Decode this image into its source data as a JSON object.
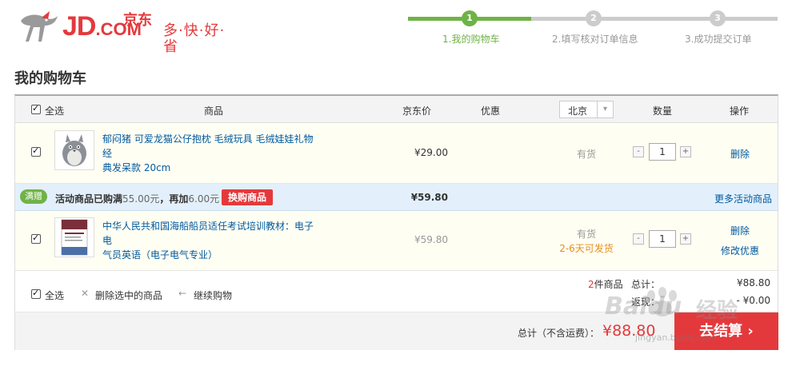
{
  "header": {
    "logo_text": "JD",
    "logo_com": ".COM",
    "logo_cn": "京东",
    "slogan": "多·快·好·省",
    "steps": [
      {
        "num": "1",
        "label": "1.我的购物车"
      },
      {
        "num": "2",
        "label": "2.填写核对订单信息"
      },
      {
        "num": "3",
        "label": "3.成功提交订单"
      }
    ]
  },
  "page_title": "我的购物车",
  "table_header": {
    "select_all": "全选",
    "product": "商品",
    "price": "京东价",
    "discount": "优惠",
    "city": "北京",
    "quantity": "数量",
    "action": "操作"
  },
  "items": [
    {
      "name_line1": "郁闷猪 可爱龙猫公仔抱枕 毛绒玩具 毛绒娃娃礼物 经",
      "name_line2": "典发呆款 20cm",
      "price": "¥29.00",
      "stock": "有货",
      "qty": "1",
      "action": "删除"
    },
    {
      "name_line1": "中华人民共和国海船船员适任考试培训教材：电子电",
      "name_line2": "气员英语（电子电气专业）",
      "price": "¥59.80",
      "stock": "有货",
      "ship": "2-6天可发货",
      "qty": "1",
      "action": "删除",
      "action2": "修改优惠"
    }
  ],
  "promo": {
    "badge": "满赠",
    "text_prefix": "活动商品已购满",
    "amount": "55.00元",
    "text_mid": "，再加",
    "need": "6.00元",
    "button": "换购商品",
    "subtotal": "¥59.80",
    "more": "更多活动商品"
  },
  "summary": {
    "select_all": "全选",
    "delete_selected": "删除选中的商品",
    "continue": "继续购物",
    "count_num": "2",
    "count_label": "件商品",
    "total_label": "总计：",
    "total_value": "¥88.80",
    "rebate_label": "返现：",
    "rebate_value": "- ¥0.00"
  },
  "footer": {
    "total_label": "总计（不含运费）：",
    "total_value": "¥88.80",
    "checkout": "去结算",
    "checkout_arrow": "›"
  },
  "watermark": {
    "brand": "Baidu",
    "cn": "经验",
    "url": "jingyan.baidu.com"
  },
  "colors": {
    "brand_red": "#e4393c",
    "step_green": "#6fb347",
    "link_blue": "#005aa0",
    "ship_orange": "#e38f1f"
  }
}
